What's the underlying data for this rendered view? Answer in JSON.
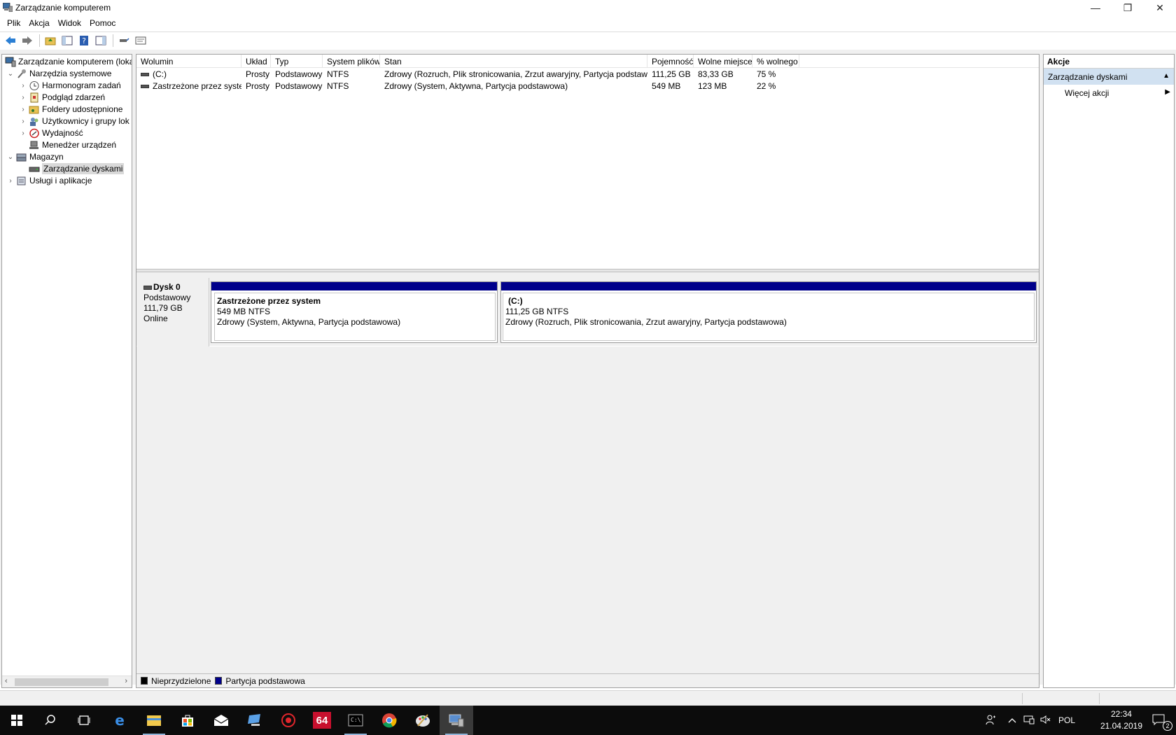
{
  "window": {
    "title": "Zarządzanie komputerem",
    "minimize": "—",
    "restore": "❐",
    "close": "✕"
  },
  "menu": [
    "Plik",
    "Akcja",
    "Widok",
    "Pomoc"
  ],
  "tree": {
    "root": "Zarządzanie komputerem (loka",
    "system_tools": "Narzędzia systemowe",
    "task_scheduler": "Harmonogram zadań",
    "event_viewer": "Podgląd zdarzeń",
    "shared_folders": "Foldery udostępnione",
    "users_groups": "Użytkownicy i grupy lok",
    "performance": "Wydajność",
    "device_manager": "Menedżer urządzeń",
    "storage": "Magazyn",
    "disk_management": "Zarządzanie dyskami",
    "services_apps": "Usługi i aplikacje"
  },
  "volumes": {
    "headers": [
      "Wolumin",
      "Układ",
      "Typ",
      "System plików",
      "Stan",
      "Pojemność",
      "Wolne miejsce",
      "% wolnego"
    ],
    "rows": [
      {
        "name": "(C:)",
        "layout": "Prosty",
        "type": "Podstawowy",
        "fs": "NTFS",
        "status": "Zdrowy (Rozruch, Plik stronicowania, Zrzut awaryjny, Partycja podstawowa)",
        "capacity": "111,25 GB",
        "free": "83,33 GB",
        "pct": "75 %"
      },
      {
        "name": "Zastrzeżone przez system",
        "layout": "Prosty",
        "type": "Podstawowy",
        "fs": "NTFS",
        "status": "Zdrowy (System, Aktywna, Partycja podstawowa)",
        "capacity": "549 MB",
        "free": "123 MB",
        "pct": "22 %"
      }
    ]
  },
  "disk": {
    "name": "Dysk 0",
    "type": "Podstawowy",
    "size": "111,79 GB",
    "state": "Online",
    "partitions": [
      {
        "name": "Zastrzeżone przez system",
        "size": "549 MB NTFS",
        "status": "Zdrowy (System, Aktywna, Partycja podstawowa)"
      },
      {
        "name": "(C:)",
        "size": "111,25 GB NTFS",
        "status": "Zdrowy (Rozruch, Plik stronicowania, Zrzut awaryjny, Partycja podstawowa)"
      }
    ]
  },
  "legend": {
    "unallocated": "Nieprzydzielone",
    "primary": "Partycja podstawowa",
    "unallocated_color": "#000000",
    "primary_color": "#00008b"
  },
  "actions": {
    "title": "Akcje",
    "section": "Zarządzanie dyskami",
    "more": "Więcej akcji"
  },
  "taskbar": {
    "lang": "POL",
    "time": "22:34",
    "date": "21.04.2019",
    "notifications": "2",
    "aida_label": "64"
  }
}
